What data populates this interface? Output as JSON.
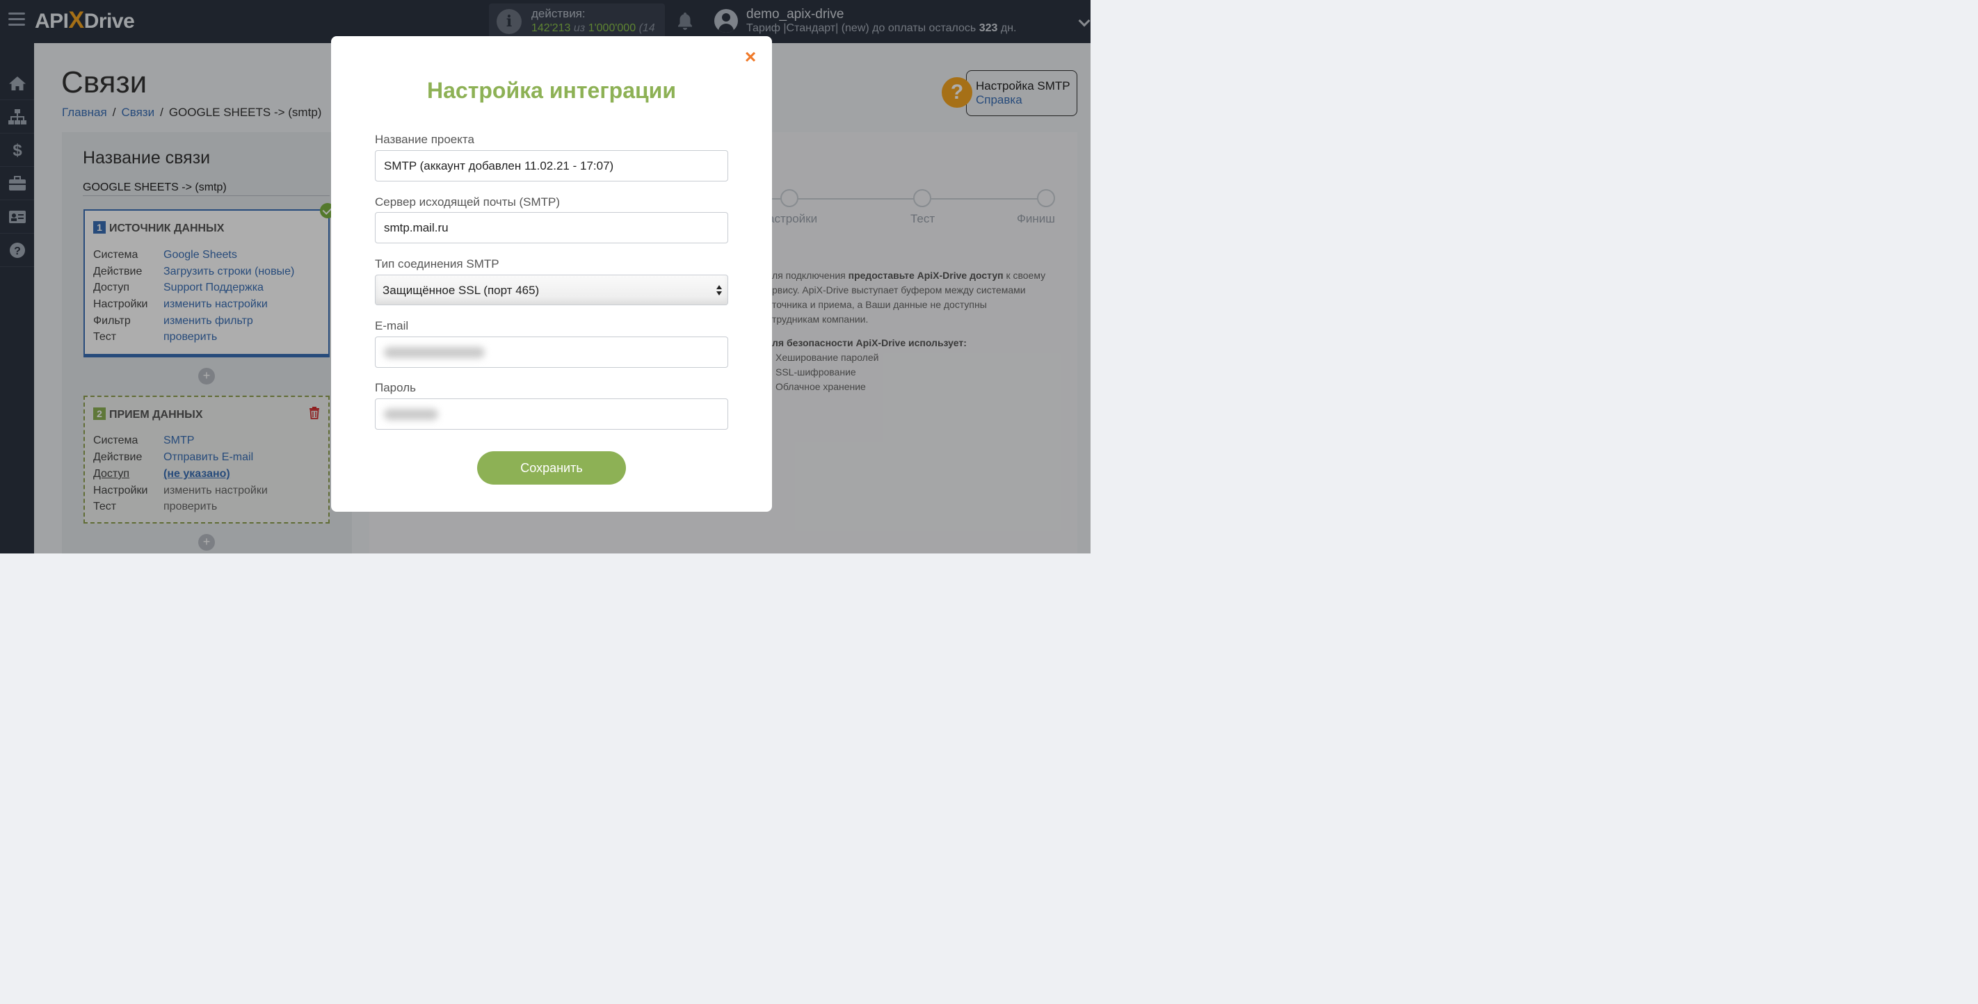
{
  "header": {
    "logo_prefix": "API",
    "logo_x": "X",
    "logo_suffix": "Drive",
    "actions_label": "действия:",
    "actions_used": "142'213",
    "actions_of": "из",
    "actions_total": "1'000'000",
    "actions_pct": "(14",
    "user_name": "demo_apix-drive",
    "plan_prefix": "Тариф |Стандарт| (new) до оплаты осталось",
    "plan_days": "323",
    "plan_suffix": "дн."
  },
  "sidebar": {
    "items": [
      "home-icon",
      "sitemap-icon",
      "dollar-icon",
      "briefcase-icon",
      "id-card-icon",
      "help-icon"
    ]
  },
  "page": {
    "title": "Связи",
    "breadcrumb": {
      "home": "Главная",
      "connections": "Связи",
      "current": "GOOGLE SHEETS -> (smtp)"
    },
    "help": {
      "title": "Настройка SMTP",
      "link": "Справка",
      "icon": "?"
    }
  },
  "connection": {
    "heading": "Название связи",
    "name": "GOOGLE SHEETS -> (smtp)",
    "source": {
      "num": "1",
      "title": "ИСТОЧНИК ДАННЫХ",
      "rows": [
        {
          "label": "Система",
          "value": "Google Sheets"
        },
        {
          "label": "Действие",
          "value": "Загрузить строки (новые)"
        },
        {
          "label": "Доступ",
          "value": "Support Поддержка"
        },
        {
          "label": "Настройки",
          "value": "изменить настройки"
        },
        {
          "label": "Фильтр",
          "value": "изменить фильтр"
        },
        {
          "label": "Тест",
          "value": "проверить"
        }
      ]
    },
    "destination": {
      "num": "2",
      "title": "ПРИЕМ ДАННЫХ",
      "rows": [
        {
          "label": "Система",
          "value": "SMTP"
        },
        {
          "label": "Действие",
          "value": "Отправить E-mail"
        },
        {
          "label": "Доступ",
          "value": "(не указано)"
        },
        {
          "label": "Настройки",
          "value": "изменить настройки"
        },
        {
          "label": "Тест",
          "value": "проверить"
        }
      ]
    },
    "plus": "+"
  },
  "steps": {
    "labels": [
      "астройки",
      "Тест",
      "Финиш"
    ]
  },
  "info": {
    "line1_pre": "ля подключения ",
    "line1_bold": "предоставьте ApiX-Drive доступ",
    "line1_post": " к своему",
    "line2": "рвису. ApiX-Drive выступает буфером между системами",
    "line3": "точника и приема, а Ваши данные не доступны",
    "line4": "трудникам компании.",
    "security_title": "ля безопасности ApiX-Drive использует:",
    "security_items": [
      "Хеширование паролей",
      "SSL-шифрование",
      "Облачное хранение"
    ]
  },
  "modal": {
    "close": "×",
    "title": "Настройка интеграции",
    "fields": {
      "project_label": "Название проекта",
      "project_value": "SMTP (аккаунт добавлен 11.02.21 - 17:07)",
      "server_label": "Сервер исходящей почты (SMTP)",
      "server_value": "smtp.mail.ru",
      "conn_type_label": "Тип соединения SMTP",
      "conn_type_value": "Защищённое SSL (порт 465)",
      "email_label": "E-mail",
      "password_label": "Пароль"
    },
    "save_label": "Сохранить"
  },
  "colors": {
    "accent_green": "#8db155",
    "link_blue": "#3a6fb5",
    "close_orange": "#f07a2a",
    "topbar": "#2d3441"
  }
}
